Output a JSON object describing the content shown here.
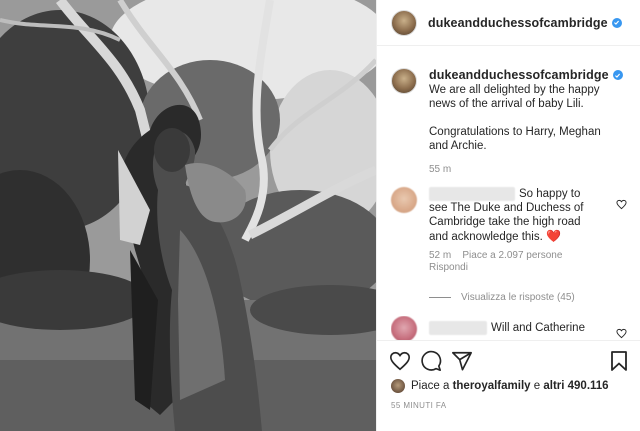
{
  "post": {
    "username": "dukeandduchessofcambridge",
    "caption": {
      "line1": "We are all delighted by the happy",
      "line2": "news of the arrival of baby Lili.",
      "line3": "Congratulations to Harry, Meghan",
      "line4": "and Archie."
    },
    "caption_time": "55 m"
  },
  "comment": {
    "text_line1": "So happy to",
    "text_line2": "see The Duke and Duchess of",
    "text_line3": "Cambridge take the high road",
    "text_line4": "and acknowledge this.",
    "emoji": "❤️",
    "time": "52 m",
    "likes": "Piace a 2.097 persone",
    "reply": "Rispondi",
    "view_replies": "Visualizza le risposte (45)"
  },
  "comment2": {
    "text": "Will and Catherine"
  },
  "actions": {
    "icons": [
      "heart-icon",
      "comment-icon",
      "share-icon",
      "bookmark-icon"
    ],
    "likes_prefix": "Piace a ",
    "likes_user": "theroyalfamily",
    "likes_mid": " e ",
    "likes_count": "altri 490.116",
    "timestamp": "55 MINUTI FA"
  },
  "colors": {
    "verified": "#3897f0",
    "muted": "#8e8e8e",
    "text": "#262626",
    "heart_emoji": "#e02020"
  }
}
